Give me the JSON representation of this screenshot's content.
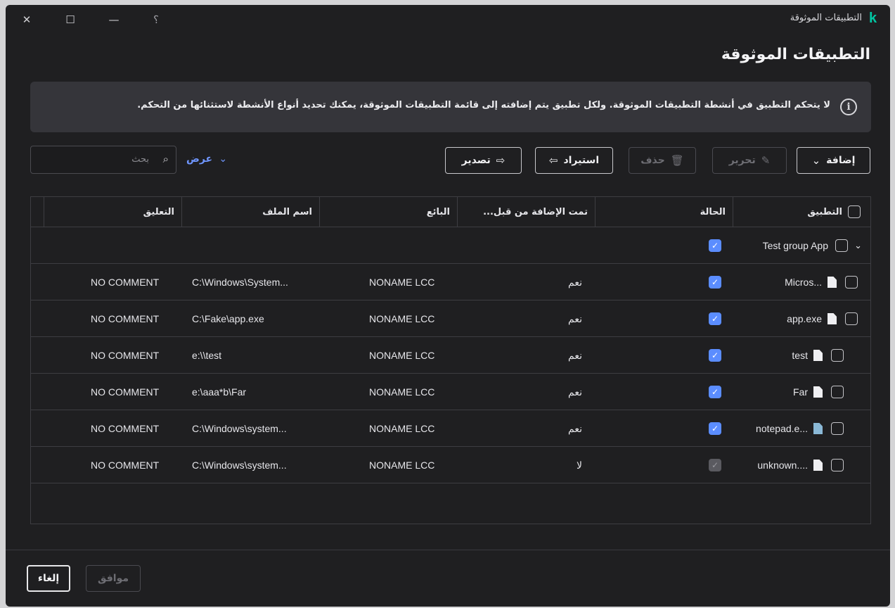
{
  "window": {
    "title": "التطبيقات الموثوقة",
    "controls": {
      "close": "✕",
      "maximize": "☐",
      "minimize": "—",
      "help": "؟"
    }
  },
  "page": {
    "title": "التطبيقات الموثوقة"
  },
  "info": {
    "text": "لا يتحكم التطبيق في أنشطة التطبيقات الموثوقة. ولكل تطبيق يتم إضافته إلى قائمة التطبيقات الموثوقة، يمكنك تحديد أنواع الأنشطة لاستثنائها من التحكم."
  },
  "toolbar": {
    "add_label": "إضافة",
    "edit_label": "تحرير",
    "delete_label": "حذف",
    "import_label": "استيراد",
    "export_label": "تصدير",
    "view_label": "عرض",
    "search_placeholder": "بحث"
  },
  "table": {
    "headers": {
      "app": "التطبيق",
      "status": "الحالة",
      "added_by": "تمت الإضافة من قبل...",
      "vendor": "البائع",
      "filename": "اسم الملف",
      "comment": "التعليق"
    },
    "group": {
      "label": "Test group App",
      "enabled": true
    },
    "rows": [
      {
        "app": "Micros...",
        "icon": "file-icon",
        "enabled": true,
        "added": "نعم",
        "vendor": "NONAME LCC",
        "file": "C:\\Windows\\System...",
        "comment": "NO COMMENT",
        "indent": true
      },
      {
        "app": "app.exe",
        "icon": "file-icon",
        "enabled": true,
        "added": "نعم",
        "vendor": "NONAME LCC",
        "file": "C:\\Fake\\app.exe",
        "comment": "NO COMMENT",
        "indent": true
      },
      {
        "app": "test",
        "icon": "file-icon",
        "enabled": true,
        "added": "نعم",
        "vendor": "NONAME LCC",
        "file": "e:\\\\test",
        "comment": "NO COMMENT",
        "indent": false
      },
      {
        "app": "Far",
        "icon": "file-icon",
        "enabled": true,
        "added": "نعم",
        "vendor": "NONAME LCC",
        "file": "e:\\aaa*b\\Far",
        "comment": "NO COMMENT",
        "indent": false
      },
      {
        "app": "notepad.e...",
        "icon": "notepad-icon",
        "enabled": true,
        "added": "نعم",
        "vendor": "NONAME LCC",
        "file": "C:\\Windows\\system...",
        "comment": "NO COMMENT",
        "indent": false
      },
      {
        "app": "unknown....",
        "icon": "file-icon",
        "enabled": true,
        "added": "لا",
        "vendor": "NONAME LCC",
        "file": "C:\\Windows\\system...",
        "comment": "NO COMMENT",
        "indent": false,
        "dim": true
      }
    ]
  },
  "footer": {
    "ok_label": "موافق",
    "cancel_label": "إلغاء"
  },
  "colors": {
    "accent": "#5b8dff",
    "brand": "#00c7a3",
    "background": "#1f1f21"
  }
}
